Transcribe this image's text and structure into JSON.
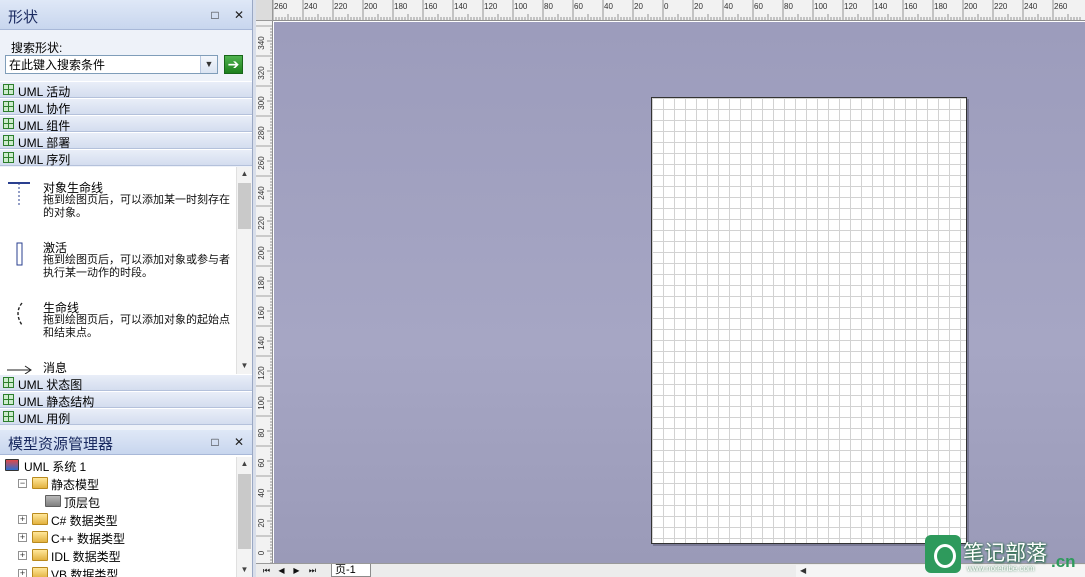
{
  "shapes_pane": {
    "title": "形状",
    "pin": "□",
    "close": "✕",
    "search_label": "搜索形状:",
    "search_value": "在此键入搜索条件",
    "stencils_top": [
      "UML 活动",
      "UML 协作",
      "UML 组件",
      "UML 部署",
      "UML 序列"
    ],
    "stencils_bottom": [
      "UML 状态图",
      "UML 静态结构",
      "UML 用例"
    ],
    "shapes": [
      {
        "name": "对象生命线",
        "desc": "拖到绘图页后，可以添加某一时刻存在的对象。"
      },
      {
        "name": "激活",
        "desc": "拖到绘图页后，可以添加对象或参与者执行某一动作的时段。"
      },
      {
        "name": "生命线",
        "desc": "拖到绘图页后，可以添加对象的起始点和结束点。"
      },
      {
        "name": "消息",
        "desc": ""
      }
    ]
  },
  "model_pane": {
    "title": "模型资源管理器",
    "pin": "□",
    "close": "✕",
    "tree": [
      {
        "label": "UML 系统 1",
        "level": 0,
        "exp": ""
      },
      {
        "label": "静态模型",
        "level": 1,
        "exp": "−"
      },
      {
        "label": "顶层包",
        "level": 2,
        "exp": ""
      },
      {
        "label": "C# 数据类型",
        "level": 1,
        "exp": "+"
      },
      {
        "label": "C++ 数据类型",
        "level": 1,
        "exp": "+"
      },
      {
        "label": "IDL 数据类型",
        "level": 1,
        "exp": "+"
      },
      {
        "label": "VB 数据类型",
        "level": 1,
        "exp": "+"
      }
    ]
  },
  "ruler": {
    "top_labels": [
      "260",
      "240",
      "220",
      "200",
      "180",
      "160",
      "140",
      "120",
      "100",
      "80",
      "60",
      "40",
      "20",
      "0",
      "20",
      "40",
      "60",
      "80",
      "100",
      "120",
      "140",
      "160",
      "180",
      "200",
      "220",
      "240",
      "260"
    ],
    "left_labels": [
      "340",
      "320",
      "300",
      "280",
      "260",
      "240",
      "220",
      "200",
      "180",
      "160",
      "140",
      "120",
      "100",
      "80",
      "60",
      "40",
      "20",
      "0"
    ]
  },
  "bottom": {
    "page_tab": "页-1"
  },
  "watermark": {
    "text": "笔记部落",
    "tld": ".cn",
    "url": "www.notetribe.com"
  }
}
